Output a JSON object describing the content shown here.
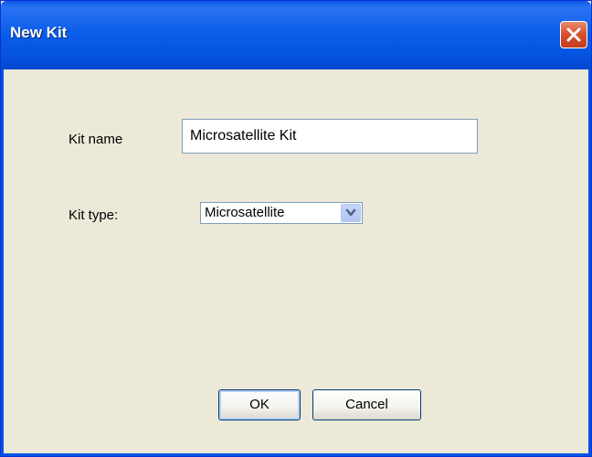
{
  "window": {
    "title": "New Kit"
  },
  "form": {
    "kit_name_label": "Kit name",
    "kit_name_value": "Microsatellite Kit",
    "kit_type_label": "Kit type:",
    "kit_type_value": "Microsatellite"
  },
  "buttons": {
    "ok_label": "OK",
    "cancel_label": "Cancel"
  },
  "icons": {
    "close": "close-icon",
    "dropdown": "chevron-down-icon"
  },
  "colors": {
    "titlebar": "#0553e0",
    "close_button": "#d6502f",
    "dialog_background": "#ece9d8"
  }
}
